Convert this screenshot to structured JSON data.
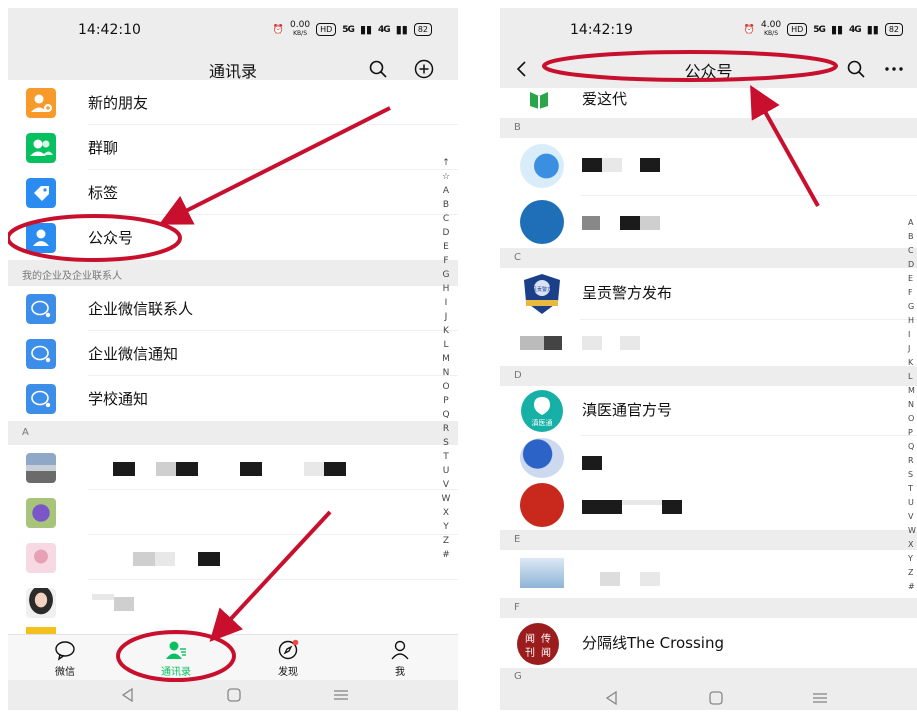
{
  "left": {
    "status": {
      "time": "14:42:10",
      "speed": "0.00",
      "speed_unit": "KB/S",
      "hd": "HD",
      "sig1": "5G",
      "sig2": "4G",
      "battery": "82"
    },
    "nav": {
      "title": "通讯录",
      "search_icon": "search-icon",
      "add_icon": "plus-circle-icon"
    },
    "top_items": [
      {
        "label": "新的朋友",
        "color": "#f79a29"
      },
      {
        "label": "群聊",
        "color": "#07c160"
      },
      {
        "label": "标签",
        "color": "#2a8cf0"
      },
      {
        "label": "公众号",
        "color": "#2a8cf0"
      }
    ],
    "enterprise_header": "我的企业及企业联系人",
    "enterprise_items": [
      {
        "label": "企业微信联系人",
        "color": "#3d8ee8"
      },
      {
        "label": "企业微信通知",
        "color": "#3d8ee8"
      },
      {
        "label": "学校通知",
        "color": "#3d8ee8"
      }
    ],
    "section_a": "A",
    "index_letters": [
      "↑",
      "☆",
      "A",
      "B",
      "C",
      "D",
      "E",
      "F",
      "G",
      "H",
      "I",
      "J",
      "K",
      "L",
      "M",
      "N",
      "O",
      "P",
      "Q",
      "R",
      "S",
      "T",
      "U",
      "V",
      "W",
      "X",
      "Y",
      "Z",
      "#"
    ],
    "tabs": [
      {
        "label": "微信",
        "icon": "chat-bubble-icon"
      },
      {
        "label": "通讯录",
        "icon": "contacts-icon"
      },
      {
        "label": "发现",
        "icon": "compass-icon"
      },
      {
        "label": "我",
        "icon": "person-icon"
      }
    ]
  },
  "right": {
    "status": {
      "time": "14:42:19",
      "speed": "4.00",
      "speed_unit": "KB/S",
      "hd": "HD",
      "sig1": "5G",
      "sig2": "4G",
      "battery": "82"
    },
    "nav": {
      "title": "公众号",
      "back_icon": "back-chevron-icon",
      "search_icon": "search-icon",
      "more_icon": "more-dots-icon"
    },
    "accounts": [
      {
        "label": "爱这代"
      },
      {
        "label": "呈贡警方发布"
      },
      {
        "label": "滇医通官方号"
      },
      {
        "label": "分隔线The Crossing"
      }
    ],
    "logo_texts": {
      "police": "呈贡警方",
      "dianyi": "滇医通",
      "crossing_tl": "闻",
      "crossing_tr": "传",
      "crossing_bl": "刊",
      "crossing_br": "闻"
    },
    "sections": [
      "B",
      "C",
      "D",
      "E",
      "F",
      "G"
    ],
    "index_letters": [
      "A",
      "B",
      "C",
      "D",
      "E",
      "F",
      "G",
      "H",
      "I",
      "J",
      "K",
      "L",
      "M",
      "N",
      "O",
      "P",
      "Q",
      "R",
      "S",
      "T",
      "U",
      "V",
      "W",
      "X",
      "Y",
      "Z",
      "#"
    ]
  }
}
